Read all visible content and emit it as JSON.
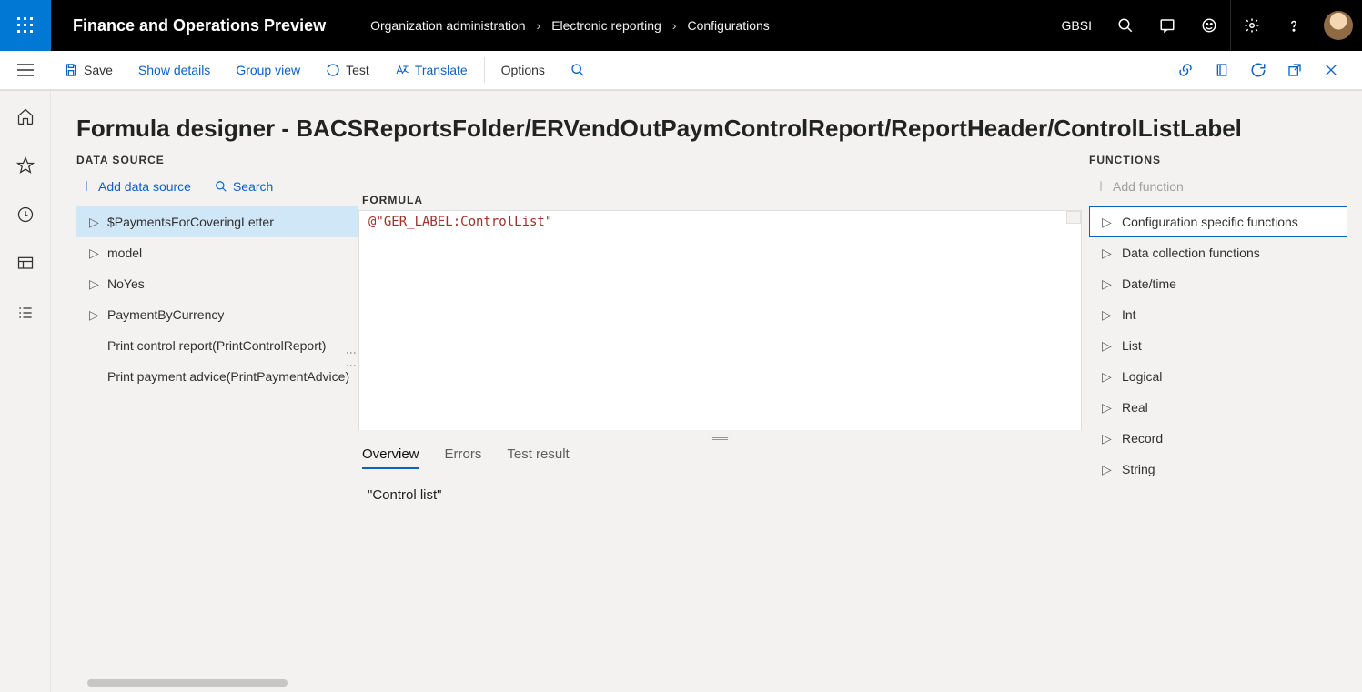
{
  "topbar": {
    "app_title": "Finance and Operations Preview",
    "breadcrumb": [
      "Organization administration",
      "Electronic reporting",
      "Configurations"
    ],
    "legal_entity": "GBSI"
  },
  "cmdbar": {
    "save": "Save",
    "show_details": "Show details",
    "group_view": "Group view",
    "test": "Test",
    "translate": "Translate",
    "options": "Options"
  },
  "page": {
    "title": "Formula designer - BACSReportsFolder/ERVendOutPaymControlReport/ReportHeader/ControlListLabel"
  },
  "datasource": {
    "header": "DATA SOURCE",
    "add": "Add data source",
    "search": "Search",
    "items": [
      {
        "label": "$PaymentsForCoveringLetter",
        "expandable": true,
        "selected": true
      },
      {
        "label": "model",
        "expandable": true
      },
      {
        "label": "NoYes",
        "expandable": true
      },
      {
        "label": "PaymentByCurrency",
        "expandable": true
      },
      {
        "label": "Print control report(PrintControlReport)",
        "expandable": false
      },
      {
        "label": "Print payment advice(PrintPaymentAdvice)",
        "expandable": false
      }
    ]
  },
  "formula": {
    "label": "FORMULA",
    "code": "@\"GER_LABEL:ControlList\"",
    "tabs": {
      "overview": "Overview",
      "errors": "Errors",
      "test_result": "Test result"
    },
    "overview_value": "\"Control list\""
  },
  "functions": {
    "header": "FUNCTIONS",
    "add": "Add function",
    "items": [
      {
        "label": "Configuration specific functions",
        "selected": true
      },
      {
        "label": "Data collection functions"
      },
      {
        "label": "Date/time"
      },
      {
        "label": "Int"
      },
      {
        "label": "List"
      },
      {
        "label": "Logical"
      },
      {
        "label": "Real"
      },
      {
        "label": "Record"
      },
      {
        "label": "String"
      }
    ]
  }
}
